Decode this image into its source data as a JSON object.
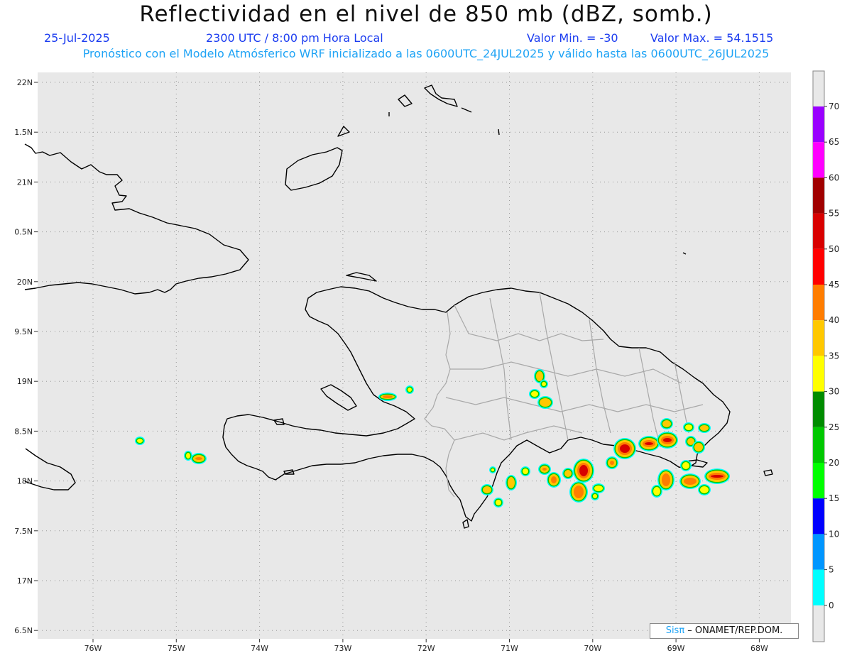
{
  "header": {
    "title": "Reflectividad en el nivel de 850 mb (dBZ, somb.)",
    "date": "25-Jul-2025",
    "time": "2300 UTC / 8:00 pm Hora Local",
    "valor_min": "Valor Min. = -30",
    "valor_max": "Valor Max. = 54.1515",
    "model_line": "Pronóstico con el Modelo Atmósferico WRF inicializado a las 0600UTC_24JUL2025 y válido hasta las  0600UTC_26JUL2025"
  },
  "map": {
    "lat_labels": [
      "22N",
      "1.5N",
      "21N",
      "0.5N",
      "20N",
      "9.5N",
      "19N",
      "8.5N",
      "18N",
      "7.5N",
      "17N",
      "6.5N"
    ],
    "lon_labels": [
      "76W",
      "75W",
      "74W",
      "73W",
      "72W",
      "71W",
      "70W",
      "69W",
      "68W"
    ],
    "background_color": "#e8e8e8",
    "coastline_color": "#000000",
    "border_color": "#a8a8a8"
  },
  "colorbar": {
    "ticks": [
      "70",
      "65",
      "60",
      "55",
      "50",
      "45",
      "40",
      "35",
      "30",
      "25",
      "20",
      "15",
      "10",
      "5",
      "0"
    ],
    "colors": [
      "#9a00ff",
      "#ff00ff",
      "#a00000",
      "#d80000",
      "#ff0000",
      "#ff7d00",
      "#ffc800",
      "#ffff00",
      "#008c00",
      "#00c800",
      "#00ff00",
      "#0000ff",
      "#0096ff",
      "#00ffff"
    ]
  },
  "credit": {
    "brand": "Sisπ",
    "text": " – ONAMET/REP.DOM."
  }
}
